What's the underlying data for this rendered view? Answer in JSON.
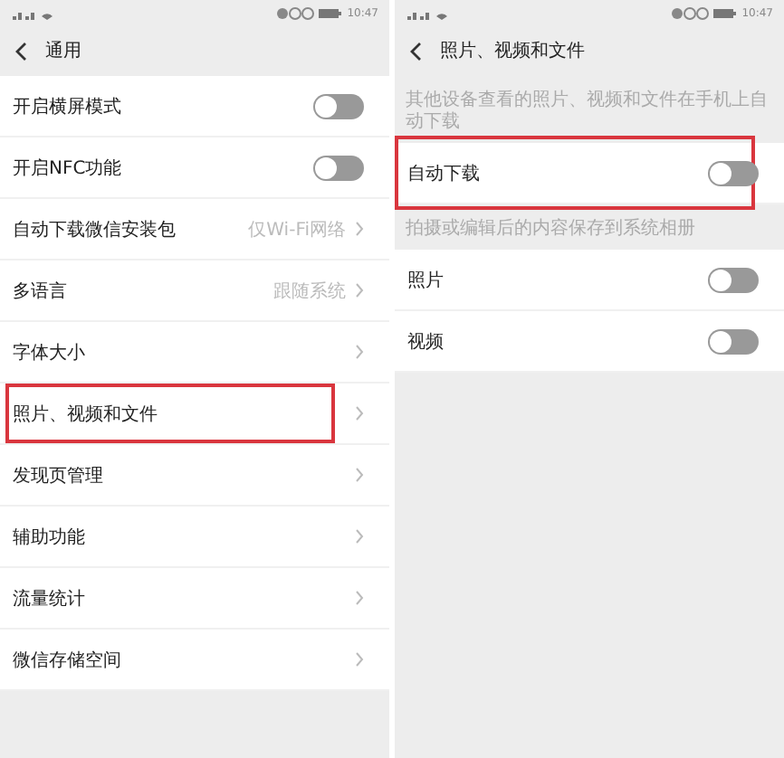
{
  "screens": [
    {
      "status_bar": {
        "time": "10:47"
      },
      "title": "通用",
      "sections": [
        {
          "rows": [
            {
              "kind": "toggle",
              "label": "开启横屏模式",
              "on": false,
              "highlighted": false
            },
            {
              "kind": "toggle",
              "label": "开启NFC功能",
              "on": false,
              "highlighted": false
            },
            {
              "kind": "link",
              "label": "自动下载微信安装包",
              "value": "仅Wi-Fi网络",
              "highlighted": false
            },
            {
              "kind": "link",
              "label": "多语言",
              "value": "跟随系统",
              "highlighted": false
            },
            {
              "kind": "link",
              "label": "字体大小",
              "highlighted": false
            },
            {
              "kind": "link",
              "label": "照片、视频和文件",
              "highlighted": true
            },
            {
              "kind": "link",
              "label": "发现页管理",
              "highlighted": false
            },
            {
              "kind": "link",
              "label": "辅助功能",
              "highlighted": false
            },
            {
              "kind": "link",
              "label": "流量统计",
              "highlighted": false
            },
            {
              "kind": "link",
              "label": "微信存储空间",
              "highlighted": false
            }
          ]
        }
      ]
    },
    {
      "status_bar": {
        "time": "10:47"
      },
      "title": "照片、视频和文件",
      "sections": [
        {
          "hint": "其他设备查看的照片、视频和文件在手机上自动下载",
          "rows": [
            {
              "kind": "toggle",
              "label": "自动下载",
              "on": false,
              "highlighted": true
            }
          ]
        },
        {
          "hint": "拍摄或编辑后的内容保存到系统相册",
          "rows": [
            {
              "kind": "toggle",
              "label": "照片",
              "on": false,
              "highlighted": false
            },
            {
              "kind": "toggle",
              "label": "视频",
              "on": false,
              "highlighted": false
            }
          ]
        }
      ]
    }
  ]
}
